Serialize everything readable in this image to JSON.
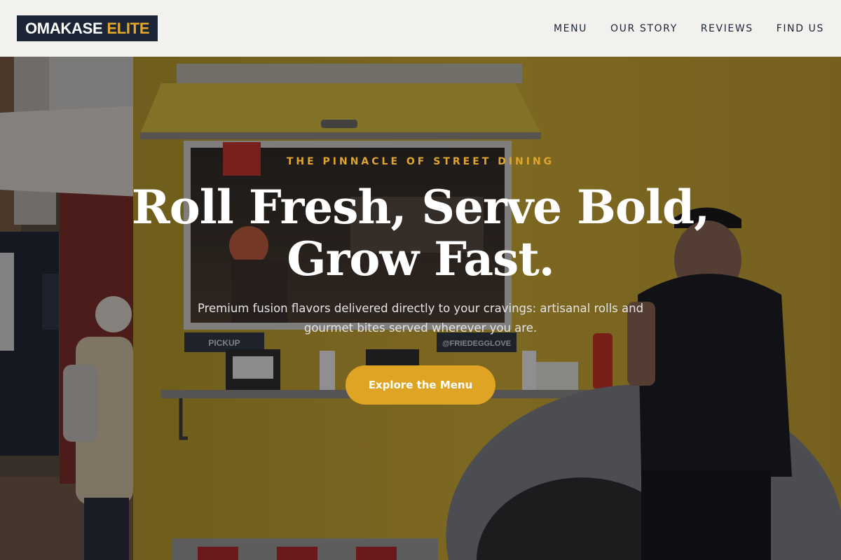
{
  "brand": {
    "name_part1": "OMAKASE",
    "name_part2": "ELITE"
  },
  "nav": {
    "items": [
      {
        "label": "MENU"
      },
      {
        "label": "OUR STORY"
      },
      {
        "label": "REVIEWS"
      },
      {
        "label": "FIND US"
      }
    ]
  },
  "hero": {
    "eyebrow": "THE PINNACLE OF STREET DINING",
    "headline_line1": "Roll Fresh, Serve Bold,",
    "headline_line2": "Grow Fast.",
    "subtitle": "Premium fusion flavors delivered directly to your cravings: artisanal rolls and gourmet bites served wherever you are.",
    "cta_label": "Explore the Menu",
    "background_signs": {
      "pickup": "PICKUP",
      "handle": "@FRIEDEGGLOVE"
    }
  },
  "colors": {
    "accent": "#dfa424",
    "brand_navy": "#1b2536",
    "header_bg": "#f2f1ee",
    "truck_yellow": "#c9a52a"
  }
}
